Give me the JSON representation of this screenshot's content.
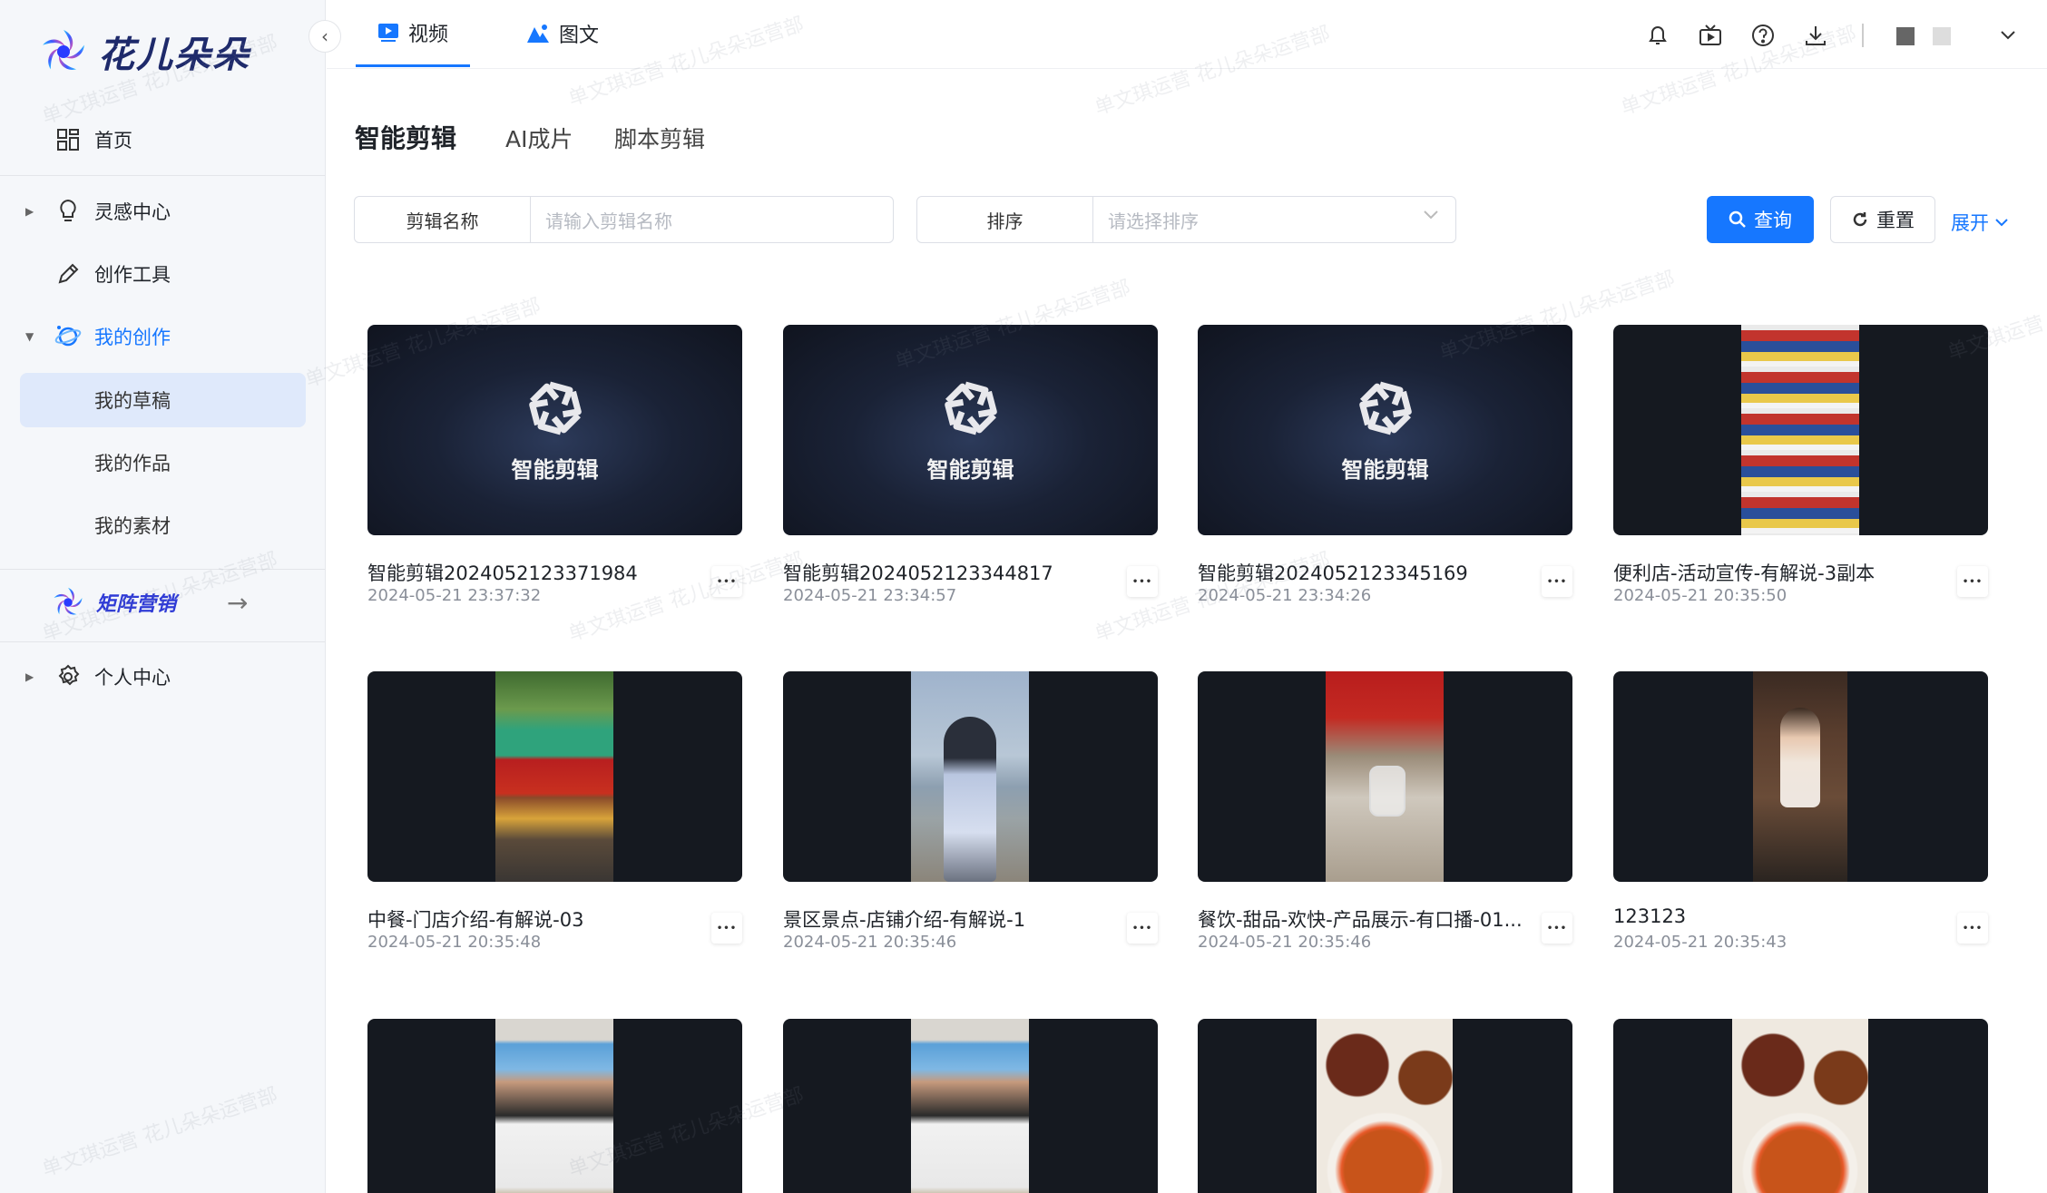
{
  "brand": {
    "name": "花儿朵朵"
  },
  "sidebar": {
    "home": "首页",
    "inspiration": "灵感中心",
    "tools": "创作工具",
    "my_creation": "我的创作",
    "sub_items": [
      "我的草稿",
      "我的作品",
      "我的素材"
    ],
    "matrix": "矩阵营销",
    "personal": "个人中心"
  },
  "topbar": {
    "tabs": [
      "视频",
      "图文"
    ]
  },
  "subtabs": [
    "智能剪辑",
    "AI成片",
    "脚本剪辑"
  ],
  "filters": {
    "name_label": "剪辑名称",
    "name_placeholder": "请输入剪辑名称",
    "sort_label": "排序",
    "sort_placeholder": "请选择排序",
    "query": "查询",
    "reset": "重置",
    "expand": "展开"
  },
  "placeholder_text": "智能剪辑",
  "watermark": "单文琪运营 花儿朵朵运营部",
  "cards": [
    {
      "title": "智能剪辑2024052123371984",
      "date": "2024-05-21 23:37:32",
      "thumb": "placeholder"
    },
    {
      "title": "智能剪辑2024052123344817",
      "date": "2024-05-21 23:34:57",
      "thumb": "placeholder"
    },
    {
      "title": "智能剪辑2024052123345169",
      "date": "2024-05-21 23:34:26",
      "thumb": "placeholder"
    },
    {
      "title": "便利店-活动宣传-有解说-3副本",
      "date": "2024-05-21 20:35:50",
      "thumb": "store-shelves"
    },
    {
      "title": "中餐-门店介绍-有解说-03",
      "date": "2024-05-21 20:35:48",
      "thumb": "restaurant-front"
    },
    {
      "title": "景区景点-店铺介绍-有解说-1",
      "date": "2024-05-21 20:35:46",
      "thumb": "lakeside-person"
    },
    {
      "title": "餐饮-甜品-欢快-产品展示-有口播-01...",
      "date": "2024-05-21 20:35:46",
      "thumb": "dessert-shop"
    },
    {
      "title": "123123",
      "date": "2024-05-21 20:35:43",
      "thumb": "livestream-host"
    },
    {
      "title": "",
      "date": "",
      "thumb": "chef-cooking"
    },
    {
      "title": "",
      "date": "",
      "thumb": "chef-cooking"
    },
    {
      "title": "",
      "date": "",
      "thumb": "food-plates"
    },
    {
      "title": "",
      "date": "",
      "thumb": "food-plates"
    }
  ]
}
